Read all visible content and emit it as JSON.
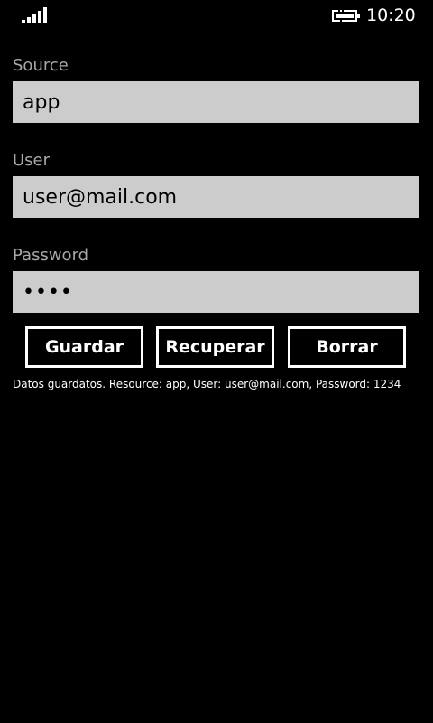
{
  "status_bar": {
    "signal_icon": "signal-strength-icon",
    "battery_icon": "battery-charging-icon",
    "time": "10:20"
  },
  "form": {
    "source": {
      "label": "Source",
      "value": "app"
    },
    "user": {
      "label": "User",
      "value": "user@mail.com"
    },
    "password": {
      "label": "Password",
      "value": "1234"
    }
  },
  "buttons": {
    "save_label": "Guardar",
    "retrieve_label": "Recuperar",
    "delete_label": "Borrar"
  },
  "message": "Datos guardatos. Resource: app, User: user@mail.com, Password: 1234",
  "colors": {
    "background": "#000000",
    "input_background": "#cccccc",
    "label": "#a8a8a8",
    "text": "#ffffff"
  }
}
